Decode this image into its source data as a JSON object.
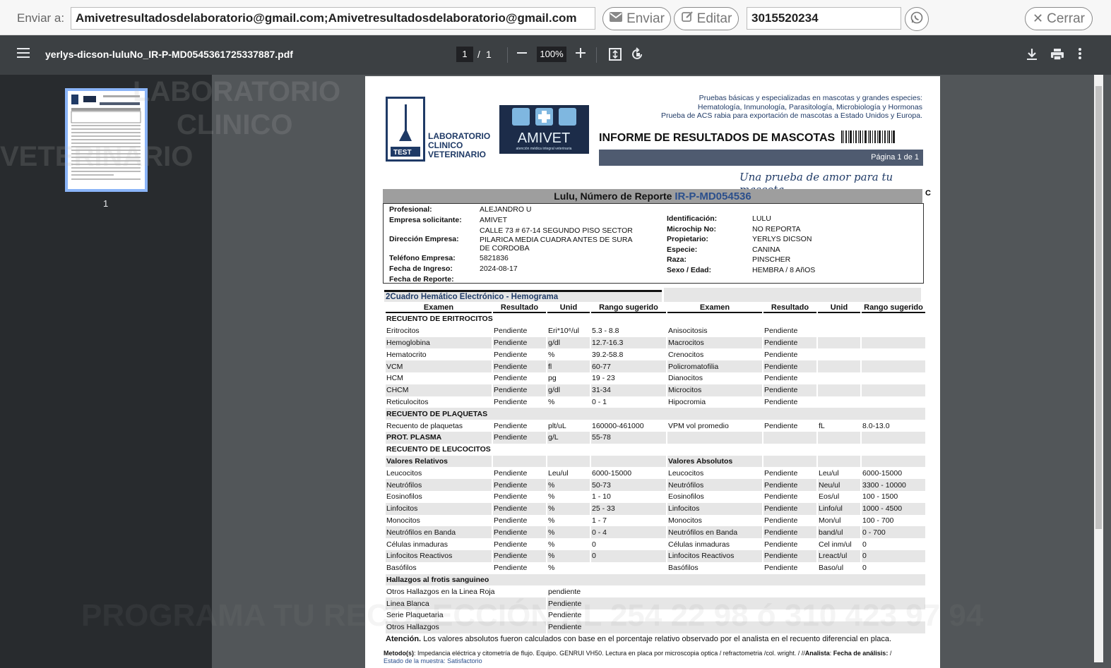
{
  "email_bar": {
    "label": "Enviar a:",
    "to_value": "Amivetresultadosdelaboratorio@gmail.com;Amivetresultadosdelaboratorio@gmail.com",
    "send_label": "Enviar",
    "edit_label": "Editar",
    "phone_value": "3015520234",
    "close_label": "Cerrar"
  },
  "pdf_toolbar": {
    "filename": "yerlys-dicson-luluNo_IR-P-MD0545361725337887.pdf",
    "current_page": "1",
    "separator": "/",
    "total_pages": "1",
    "zoom": "100%"
  },
  "sidebar": {
    "thumb_label": "1"
  },
  "watermark": {
    "line1": "LABORATORIO",
    "line2": "CLINICO",
    "line3": "VETERINARIO",
    "line4": "PROGRAMA TU RECOLECCIÓN AL 254 22 98 ó 310 423 97 94"
  },
  "report": {
    "lab_name": [
      "LABORATORIO",
      "CLINICO",
      "VETERINARIO"
    ],
    "lab_logo_word": "TEST",
    "partner_logo_text": "AMIVET",
    "partner_tagline": "atención médica integral veterinaria",
    "services": [
      "Pruebas básicas y especializadas en mascotas y grandes especies:",
      "Hematología, Inmunología, Parasitología, Microbiología y Hormonas",
      "Prueba de ACS rabia para exportación de mascotas a Estado Unidos y Europa."
    ],
    "title": "INFORME DE RESULTADOS DE MASCOTAS",
    "page_label": "Página 1 de 1",
    "slogan": "Una prueba de amor para tu mascota",
    "pet_heading": "Lulu, Número de Reporte",
    "report_code": "IR-P-MD054536",
    "c_mark": "C",
    "left_info": [
      {
        "k": "Profesional:",
        "v": "ALEJANDRO U"
      },
      {
        "k": "Empresa solicitante:",
        "v": "AMIVET"
      },
      {
        "k": "Dirección Empresa:",
        "v": "CALLE 73 # 67-14 SEGUNDO PISO SECTOR PILARICA MEDIA CUADRA ANTES DE SURA DE CORDOBA"
      },
      {
        "k": "Teléfono Empresa:",
        "v": "5821836"
      },
      {
        "k": "Fecha de Ingreso:",
        "v": "2024-08-17"
      },
      {
        "k": "Fecha de Reporte:",
        "v": ""
      }
    ],
    "right_info": [
      {
        "k": "Identificación:",
        "v": "LULU"
      },
      {
        "k": "Microchip No:",
        "v": "NO REPORTA"
      },
      {
        "k": "Propietario:",
        "v": "YERLYS DICSON"
      },
      {
        "k": "Especie:",
        "v": "CANINA"
      },
      {
        "k": "Raza:",
        "v": "PINSCHER"
      },
      {
        "k": "Sexo / Edad:",
        "v": "HEMBRA / 8 AñOS"
      }
    ],
    "section_title": "2Cuadro Hemático Electrónico - Hemograma",
    "columns": [
      "Examen",
      "Resultado",
      "Unid",
      "Rango sugerido",
      "Examen",
      "Resultado",
      "Unid",
      "Rango sugerido"
    ],
    "note_bold": "Atención.",
    "note_text": "Los valores absolutos fueron calculados con base en el porcentaje relativo observado por el analista en el recuento diferencial en placa.",
    "method_label": "Metodo(s)",
    "method_text": ": Impedancia eléctrica y citometría de flujo. Equipo. GENRUI VH50. Lectura en placa por microscopia optica / refractometria /col. wright. / //",
    "analyst_label": "Analista",
    "date_label": "Fecha de análisis:",
    "state_label": "Estado de la muestra:",
    "state_value": "Satisfactorio"
  }
}
